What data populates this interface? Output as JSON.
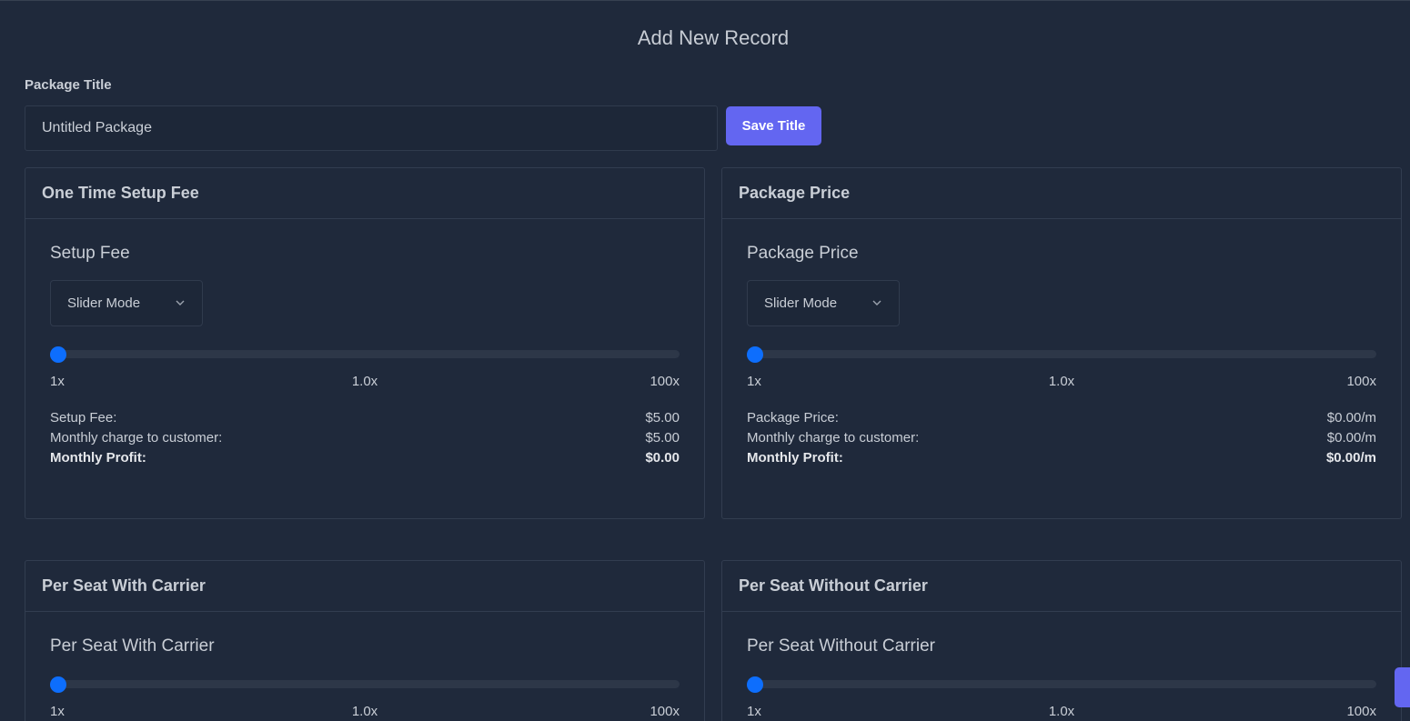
{
  "page": {
    "title": "Add New Record"
  },
  "package_title": {
    "label": "Package Title",
    "value": "Untitled Package",
    "save_label": "Save Title"
  },
  "colors": {
    "background": "#1f293b",
    "accent": "#6366f1",
    "slider_thumb": "#0d6efd"
  },
  "cards": {
    "setup": {
      "header": "One Time Setup Fee",
      "section_title": "Setup Fee",
      "mode": "Slider Mode",
      "slider": {
        "min_label": "1x",
        "mid_label": "1.0x",
        "max_label": "100x",
        "value": 1
      },
      "summary": [
        {
          "label": "Setup Fee:",
          "value": "$5.00"
        },
        {
          "label": "Monthly charge to customer:",
          "value": "$5.00"
        },
        {
          "label": "Monthly Profit:",
          "value": "$0.00"
        }
      ]
    },
    "price": {
      "header": "Package Price",
      "section_title": "Package Price",
      "mode": "Slider Mode",
      "slider": {
        "min_label": "1x",
        "mid_label": "1.0x",
        "max_label": "100x",
        "value": 1
      },
      "summary": [
        {
          "label": "Package Price:",
          "value": "$0.00/m"
        },
        {
          "label": "Monthly charge to customer:",
          "value": "$0.00/m"
        },
        {
          "label": "Monthly Profit:",
          "value": "$0.00/m"
        }
      ]
    },
    "with_carrier": {
      "header": "Per Seat With Carrier",
      "section_title": "Per Seat With Carrier",
      "slider": {
        "min_label": "1x",
        "mid_label": "1.0x",
        "max_label": "100x",
        "value": 1
      }
    },
    "without_carrier": {
      "header": "Per Seat Without Carrier",
      "section_title": "Per Seat Without Carrier",
      "slider": {
        "min_label": "1x",
        "mid_label": "1.0x",
        "max_label": "100x",
        "value": 1
      }
    }
  }
}
